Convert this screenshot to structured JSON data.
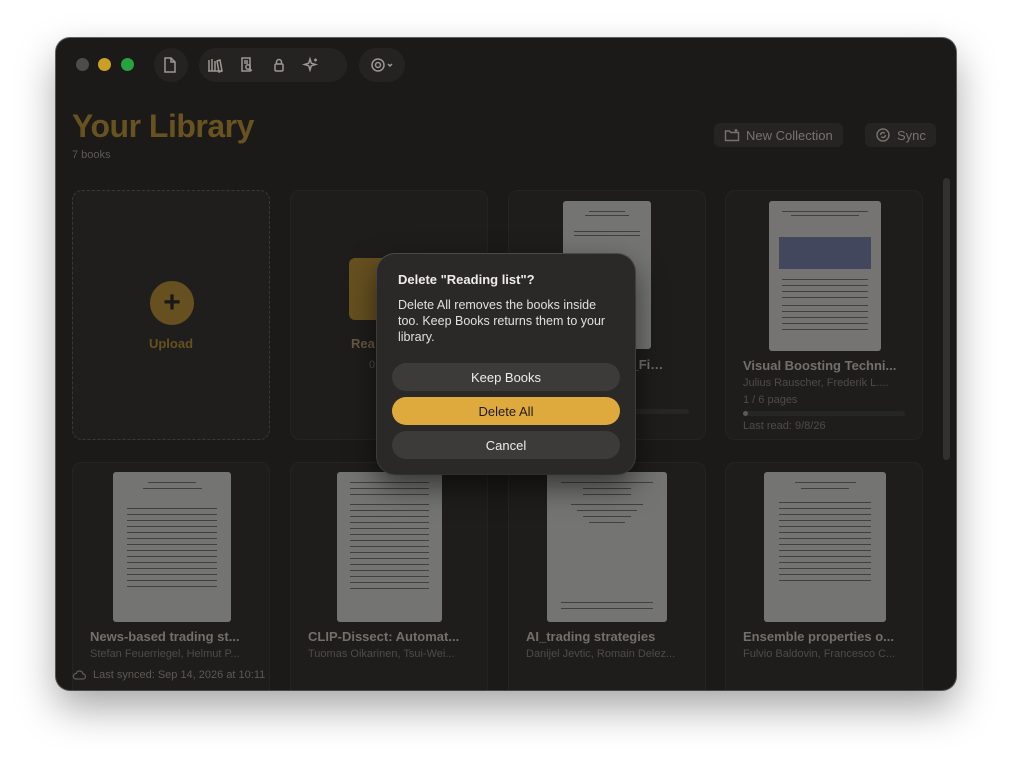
{
  "toolbar": {
    "icons": [
      "document-icon",
      "library-icon",
      "search-document-icon",
      "lock-icon",
      "sparkle-icon",
      "settings-icon"
    ]
  },
  "header": {
    "title": "Your Library",
    "subtitle": "7 books",
    "new_collection_label": "New Collection",
    "sync_label": "Sync"
  },
  "upload": {
    "label": "Upload"
  },
  "collection": {
    "label": "Rea",
    "count": "0"
  },
  "books": [
    {
      "title": "…_to_Fi…",
      "authors": "",
      "pages": "",
      "progress": 0,
      "last_read": ""
    },
    {
      "title": "Visual Boosting Techni...",
      "authors": "Julius Rauscher, Frederik L....",
      "pages": "1 / 6 pages",
      "progress": 0.03,
      "last_read": "Last read: 9/8/26"
    },
    {
      "title": "News-based trading st...",
      "authors": "Stefan Feuerriegel, Helmut P...",
      "pages": ""
    },
    {
      "title": "CLIP-Dissect: Automat...",
      "authors": "Tuomas Oikarinen, Tsui-Wei...",
      "pages": ""
    },
    {
      "title": "AI_trading strategies",
      "authors": "Danijel Jevtic, Romain Delez...",
      "pages": ""
    },
    {
      "title": "Ensemble properties o...",
      "authors": "Fulvio Baldovin, Francesco C...",
      "pages": ""
    }
  ],
  "status": {
    "text": "Last synced: Sep 14, 2026 at 10:11"
  },
  "dialog": {
    "title": "Delete \"Reading list\"?",
    "body": "Delete All removes the books inside too. Keep Books returns them to your library.",
    "keep_label": "Keep Books",
    "delete_label": "Delete All",
    "cancel_label": "Cancel"
  },
  "colors": {
    "accent": "#dfaa3d",
    "background": "#1f1e1d"
  }
}
